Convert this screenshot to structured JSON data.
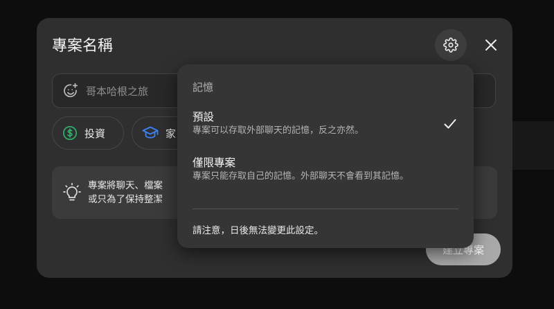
{
  "dialog": {
    "title": "專案名稱",
    "name_placeholder": "哥本哈根之旅",
    "chips": [
      {
        "label": "投資",
        "icon": "dollar-circle-icon"
      },
      {
        "label": "家",
        "icon": "graduation-cap-icon"
      }
    ],
    "tip_lines": [
      "專案將聊天、檔案",
      "或只為了保持整潔"
    ],
    "create_label": "建立專案"
  },
  "memory_menu": {
    "header": "記憶",
    "options": [
      {
        "label": "預設",
        "description": "專案可以存取外部聊天的記憶，反之亦然。",
        "selected": true
      },
      {
        "label": "僅限專案",
        "description": "專案只能存取自己的記憶。外部聊天不會看到其記憶。",
        "selected": false
      }
    ],
    "note": "請注意，日後無法變更此設定。"
  },
  "colors": {
    "dialog_bg": "#2f2f2f",
    "menu_bg": "#353535",
    "dollar_green": "#2fb36a",
    "cap_blue": "#3b82f6"
  }
}
